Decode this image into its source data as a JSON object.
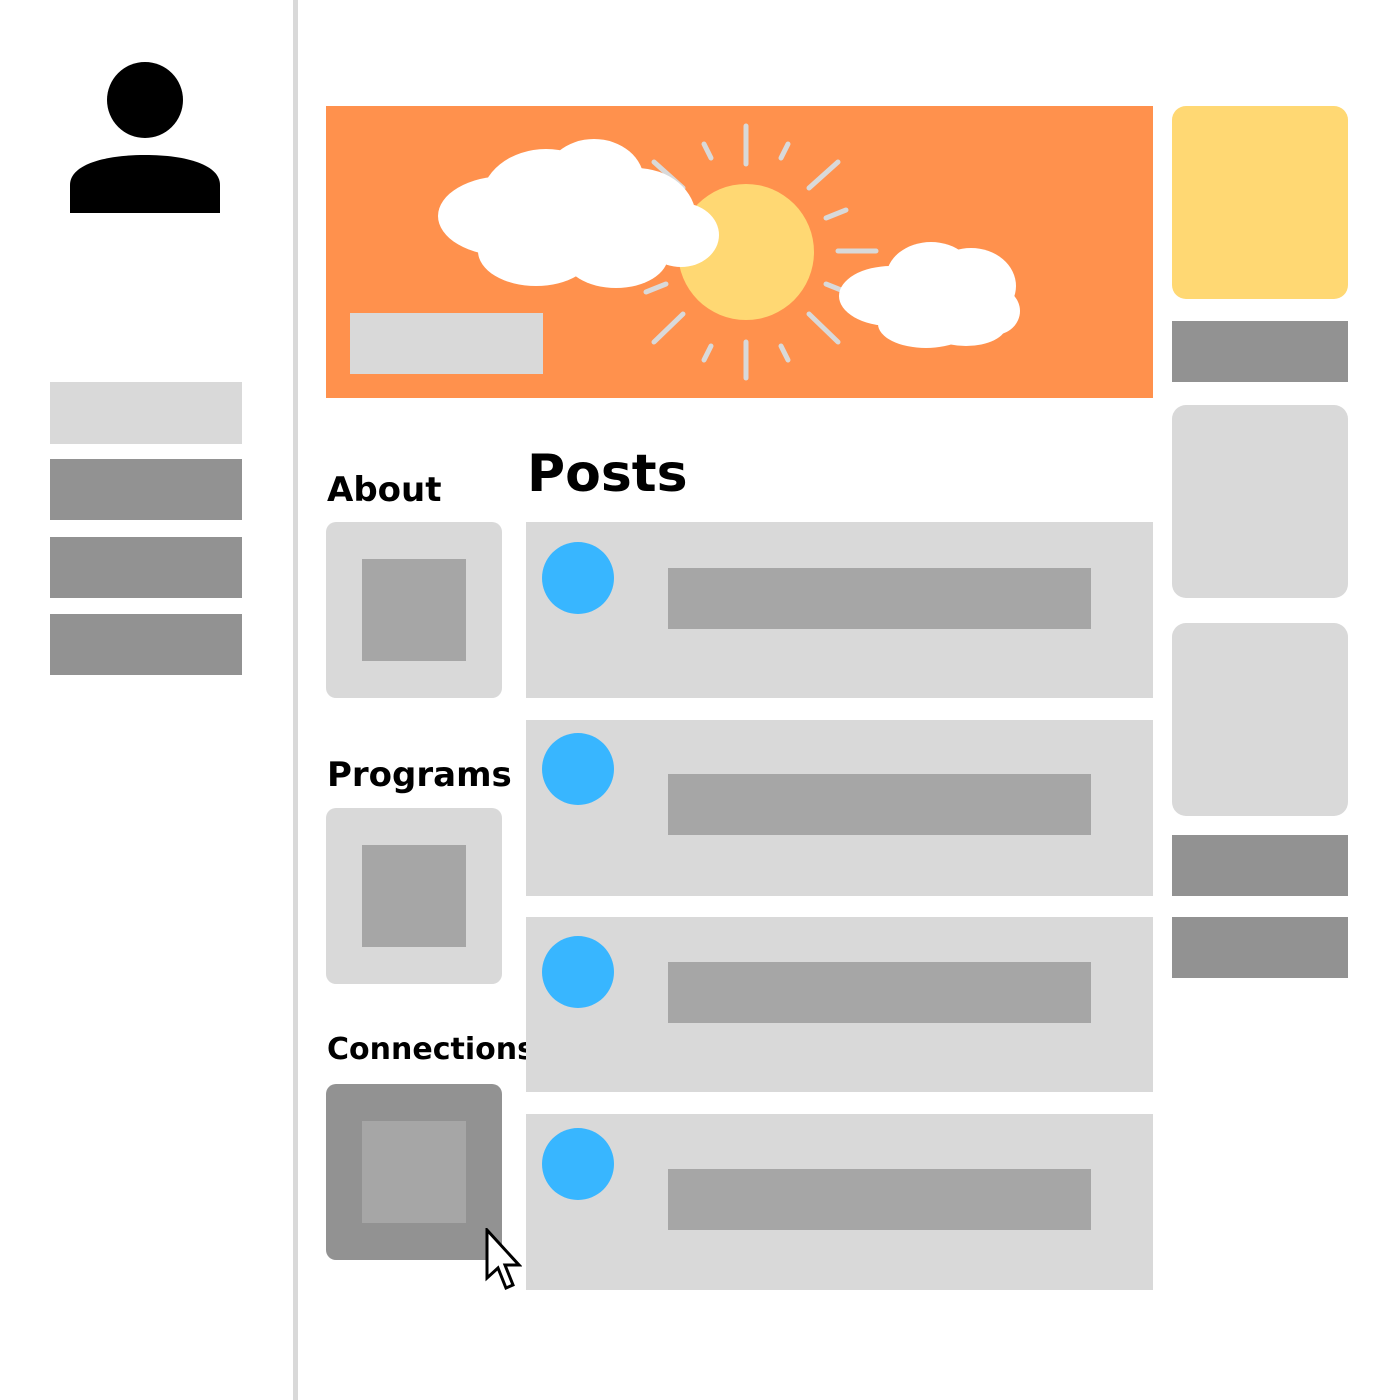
{
  "sections": {
    "about": "About",
    "programs": "Programs",
    "connections": "Connections",
    "posts": "Posts"
  },
  "colors": {
    "banner_background": "#ff914d",
    "sun": "#ffd873",
    "cloud": "#ffffff",
    "sun_rays": "#d9d9d9",
    "avatar": "#38b6ff",
    "widget_accent": "#ffd873",
    "placeholder_light": "#d9d9d9",
    "placeholder_mid": "#a6a6a6",
    "placeholder_dark": "#929292"
  },
  "icons": {
    "profile": "user-icon",
    "cursor": "mouse-pointer-icon",
    "banner": "sun-and-clouds-illustration"
  },
  "sidebar": {
    "selected_index": 0,
    "item_count": 4
  },
  "posts": {
    "count": 4
  },
  "left_cards": {
    "active": "connections"
  }
}
